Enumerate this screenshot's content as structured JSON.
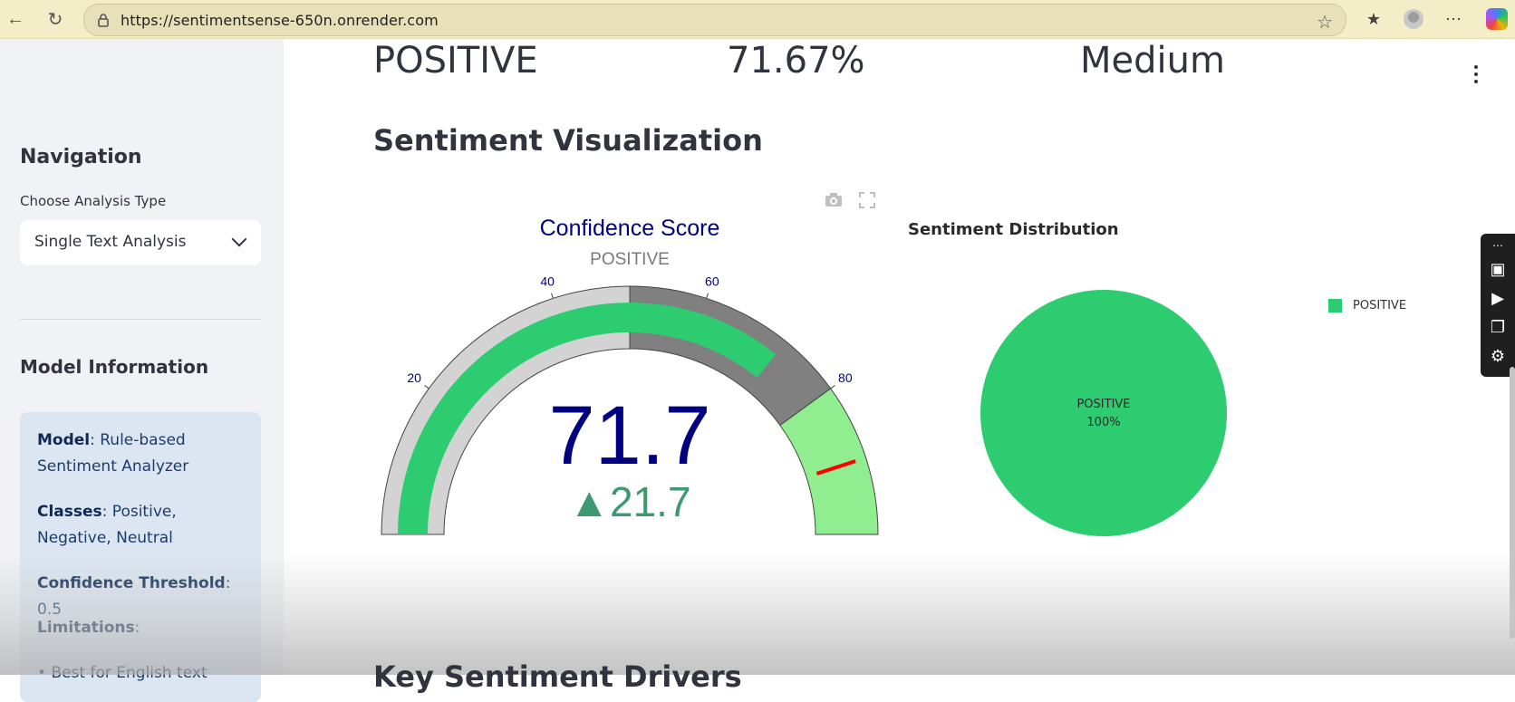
{
  "browser": {
    "url": "https://sentimentsense-650n.onrender.com"
  },
  "sidebar": {
    "nav_heading": "Navigation",
    "choose_label": "Choose Analysis Type",
    "select_value": "Single Text Analysis",
    "model_heading": "Model Information",
    "model_label": "Model",
    "model_value": ": Rule-based Sentiment Analyzer",
    "classes_label": "Classes",
    "classes_value": ": Positive, Negative, Neutral",
    "threshold_label": "Confidence Threshold",
    "threshold_value": ": 0.5",
    "limitations_label": "Limitations",
    "limitations_colon": ":",
    "bullet_text": "Best for English text"
  },
  "metrics": {
    "sentiment": "POSITIVE",
    "confidence": "71.67%",
    "intensity": "Medium"
  },
  "section_title": "Sentiment Visualization",
  "next_section_title": "Key Sentiment Drivers",
  "chart_data": [
    {
      "type": "gauge",
      "title": "Confidence Score",
      "subtitle": "POSITIVE",
      "value": 71.7,
      "delta": 21.7,
      "delta_symbol": "▲",
      "range": [
        0,
        100
      ],
      "tick_labels": [
        "20",
        "40",
        "60",
        "80"
      ],
      "ticks": [
        20,
        40,
        60,
        80
      ],
      "steps": [
        {
          "range": [
            0,
            50
          ],
          "color": "#d3d3d3"
        },
        {
          "range": [
            50,
            80
          ],
          "color": "#808080"
        },
        {
          "range": [
            80,
            100
          ],
          "color": "#90ee90"
        }
      ],
      "bar_color": "#2ecc71",
      "threshold": 90,
      "threshold_color": "#ff0000"
    },
    {
      "type": "pie",
      "title": "Sentiment Distribution",
      "labels": [
        "POSITIVE"
      ],
      "values": [
        100
      ],
      "slice_label": "POSITIVE",
      "slice_percent": "100%",
      "colors": [
        "#2ecc71"
      ],
      "legend_position": "top-right"
    }
  ],
  "colors": {
    "title_blue": "#000080",
    "delta_green": "#3d9970",
    "gauge_bar": "#2ecc71"
  }
}
